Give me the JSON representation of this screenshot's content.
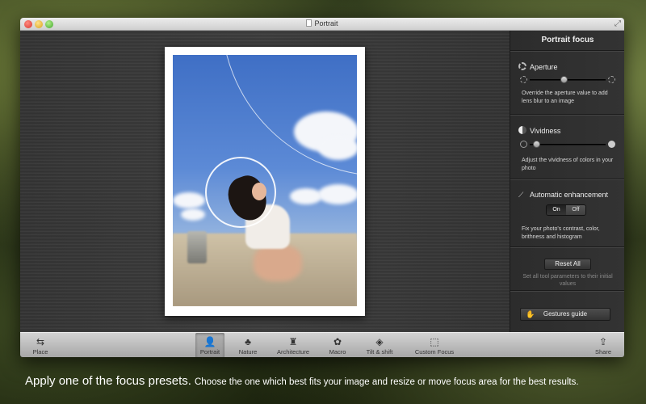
{
  "window": {
    "title": "Portrait"
  },
  "panel": {
    "title": "Portrait focus",
    "aperture": {
      "label": "Aperture",
      "description": "Override the aperture value to add lens blur to an image",
      "value_fraction": 0.45
    },
    "vividness": {
      "label": "Vividness",
      "description": "Adjust the vividness of colors in your photo",
      "value_fraction": 0.05
    },
    "enhancement": {
      "label": "Automatic enhancement",
      "on_label": "On",
      "off_label": "Off",
      "selected": "On",
      "description": "Fix your photo's contrast, color, brithness and histogram"
    },
    "reset": {
      "label": "Reset All",
      "note": "Set all tool parameters to their initial values"
    },
    "gestures": {
      "label": "Gestures guide"
    }
  },
  "toolbar": {
    "place": "Place",
    "presets": [
      {
        "label": "Portrait",
        "icon": "portrait-icon",
        "active": true
      },
      {
        "label": "Nature",
        "icon": "tree-icon",
        "active": false
      },
      {
        "label": "Architecture",
        "icon": "statue-icon",
        "active": false
      },
      {
        "label": "Macro",
        "icon": "flower-icon",
        "active": false
      },
      {
        "label": "Tilt & shift",
        "icon": "tilt-shift-icon",
        "active": false
      },
      {
        "label": "Custom Focus",
        "icon": "custom-focus-icon",
        "active": false
      }
    ],
    "share": "Share"
  },
  "caption": {
    "lead": "Apply one of the focus presets.",
    "rest": "Choose the one which best fits your image and resize or move focus area for the best results."
  },
  "colors": {
    "panel_bg": "#2f2f2f",
    "canvas_bg": "#3a3a3a",
    "toolbar_bg": "#bdbdbd"
  }
}
